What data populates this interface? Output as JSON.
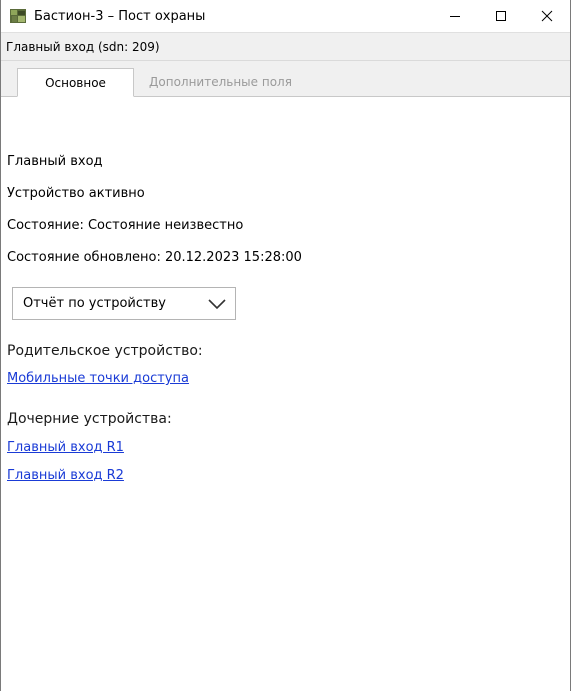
{
  "window": {
    "title": "Бастион-3 – Пост охраны",
    "controls": {
      "minimize": "minimize-icon",
      "maximize": "maximize-icon",
      "close": "close-icon"
    }
  },
  "device_header": "Главный вход (sdn: 209)",
  "tabs": [
    {
      "label": "Основное",
      "active": true
    },
    {
      "label": "Дополнительные поля",
      "active": false
    }
  ],
  "main": {
    "device_name": "Главный вход",
    "device_status": "Устройство активно",
    "state": "Состояние: Состояние неизвестно",
    "state_updated": "Состояние обновлено: 20.12.2023 15:28:00",
    "report_button": "Отчёт по устройству",
    "parent_label": "Родительское устройство:",
    "parent_link": "Мобильные точки доступа",
    "children_label": "Дочерние устройства:",
    "children": [
      "Главный вход R1",
      "Главный вход R2"
    ]
  },
  "colors": {
    "link": "#1a3bd6",
    "inactive_tab": "#9a9a9a",
    "header_bg": "#f0f0f0"
  }
}
